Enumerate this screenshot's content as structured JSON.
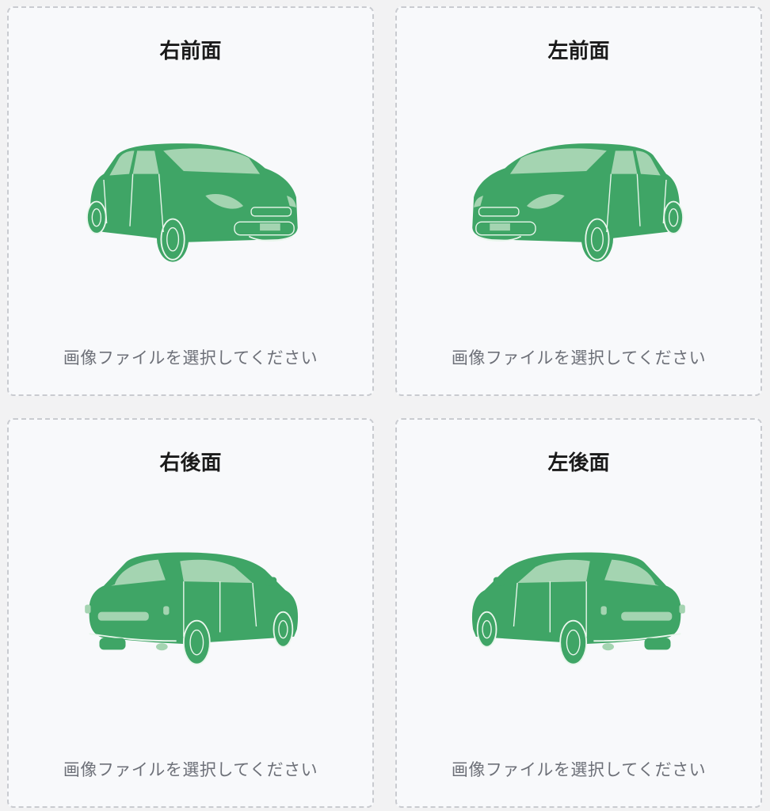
{
  "cards": [
    {
      "title": "右前面",
      "hint": "画像ファイルを選択してください",
      "icon": "car-front-right-icon"
    },
    {
      "title": "左前面",
      "hint": "画像ファイルを選択してください",
      "icon": "car-front-left-icon"
    },
    {
      "title": "右後面",
      "hint": "画像ファイルを選択してください",
      "icon": "car-rear-right-icon"
    },
    {
      "title": "左後面",
      "hint": "画像ファイルを選択してください",
      "icon": "car-rear-left-icon"
    }
  ],
  "colors": {
    "car": "#3fa566",
    "glass": "#a4d4b1",
    "line": "#e9f6ec",
    "border": "#c9cbd0",
    "background": "#f8f9fb"
  }
}
